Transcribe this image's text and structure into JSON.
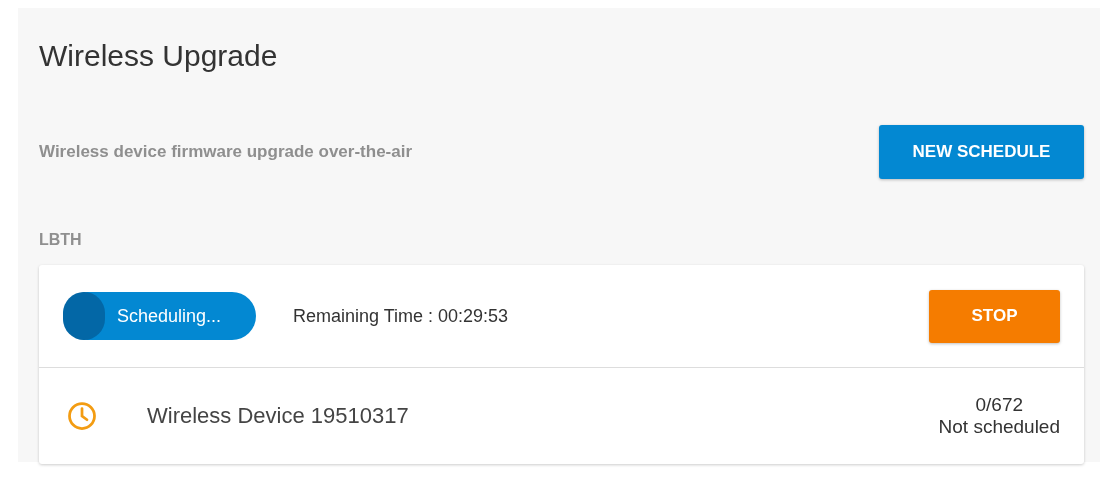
{
  "title": "Wireless Upgrade",
  "subtitle": "Wireless device firmware upgrade over-the-air",
  "new_schedule_button": "NEW SCHEDULE",
  "group": {
    "name": "LBTH",
    "status": {
      "label": "Scheduling...",
      "remaining": "Remaining Time : 00:29:53",
      "stop_button": "STOP"
    },
    "devices": [
      {
        "name": "Wireless Device 19510317",
        "progress": "0/672",
        "state": "Not scheduled"
      }
    ]
  }
}
